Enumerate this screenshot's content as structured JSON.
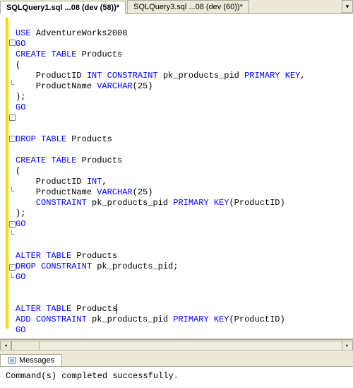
{
  "tabs": {
    "active": "SQLQuery1.sql ...08 (dev (58))*",
    "other": "SQLQuery3.sql ...08 (dev (60))*"
  },
  "code": {
    "l1_kw": "USE",
    "l1_txt": " AdventureWorks2008",
    "l2": "GO",
    "l3_kw1": "CREATE",
    "l3_kw2": "TABLE",
    "l3_txt": " Products",
    "l4": "(",
    "l5_txt1": "    ProductID ",
    "l5_ty": "INT",
    "l5_kw": " CONSTRAINT",
    "l5_txt2": " pk_products_pid ",
    "l5_kw2": "PRIMARY KEY",
    "l5_comma": ",",
    "l6_txt1": "    ProductName ",
    "l6_ty": "VARCHAR",
    "l6_txt2": "(25)",
    "l7": ");",
    "l8": "GO",
    "blank": "",
    "l10_kw1": "DROP",
    "l10_kw2": "TABLE",
    "l10_txt": " Products",
    "l12_kw1": "CREATE",
    "l12_kw2": "TABLE",
    "l12_txt": " Products",
    "l13": "(",
    "l14_txt1": "    ProductID ",
    "l14_ty": "INT",
    "l14_comma": ",",
    "l15_txt1": "    ProductName ",
    "l15_ty": "VARCHAR",
    "l15_txt2": "(25)",
    "l16_kw": "    CONSTRAINT",
    "l16_txt1": " pk_products_pid ",
    "l16_kw2": "PRIMARY KEY",
    "l16_txt2": "(ProductID)",
    "l17": ");",
    "l18": "GO",
    "l20_kw1": "ALTER",
    "l20_kw2": "TABLE",
    "l20_txt": " Products",
    "l21_kw1": "DROP",
    "l21_kw2": "CONSTRAINT",
    "l21_txt": " pk_products_pid;",
    "l22": "GO",
    "l24_kw1": "ALTER",
    "l24_kw2": "TABLE",
    "l24_txt": " Products",
    "l25_kw1": "ADD",
    "l25_kw2": "CONSTRAINT",
    "l25_txt1": " pk_products_pid ",
    "l25_kw3": "PRIMARY KEY",
    "l25_txt2": "(ProductID)",
    "l26": "GO"
  },
  "messages": {
    "tab": "Messages",
    "text": "Command(s) completed successfully."
  }
}
